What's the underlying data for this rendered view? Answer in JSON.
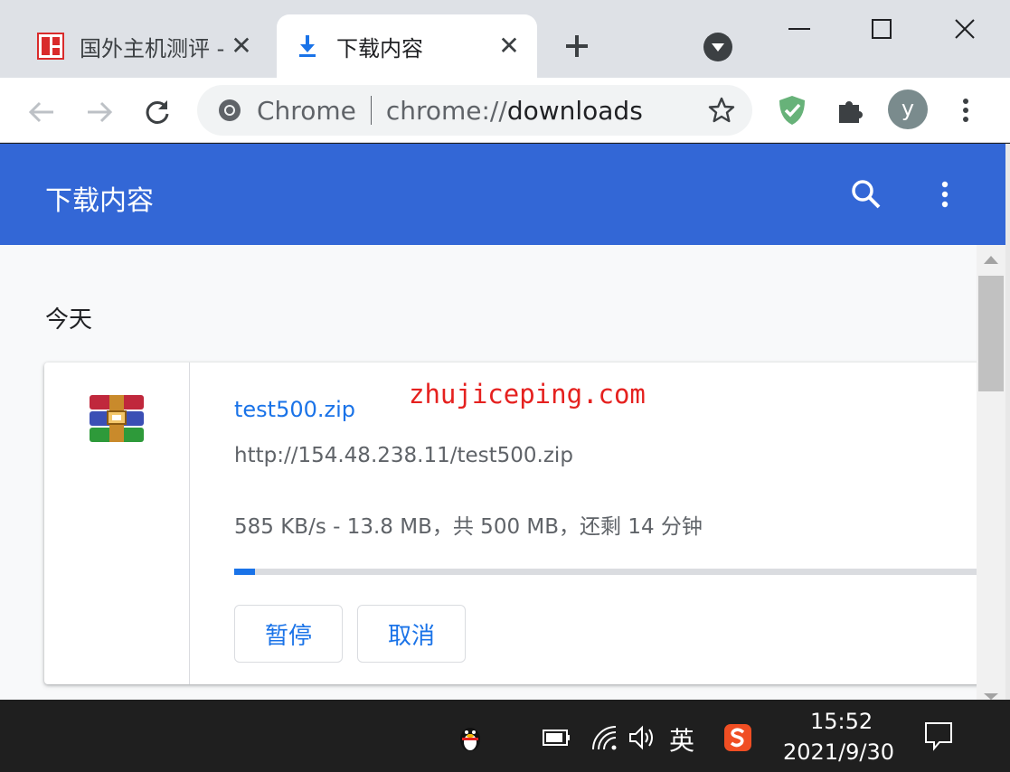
{
  "tabs": [
    {
      "title": "国外主机测评 - ",
      "close": "✕",
      "icon": "site-favicon-red"
    },
    {
      "title": "下载内容",
      "close": "✕",
      "icon": "download-icon"
    }
  ],
  "toolbar": {
    "omnibox_chip": "Chrome",
    "url_scheme": "chrome://",
    "url_path": "downloads",
    "avatar_letter": "y"
  },
  "downloads_page": {
    "title": "下载内容",
    "section_today": "今天",
    "item": {
      "file_name": "test500.zip",
      "watermark": "zhujiceping.com",
      "url": "http://154.48.238.11/test500.zip",
      "status": "585 KB/s - 13.8 MB，共 500 MB，还剩 14 分钟",
      "progress_fraction": 0.0276,
      "pause_label": "暂停",
      "cancel_label": "取消"
    }
  },
  "taskbar": {
    "lang": "英",
    "time": "15:52",
    "date": "2021/9/30"
  },
  "colors": {
    "header_blue": "#3367d6",
    "link_blue": "#1a73e8",
    "watermark_red": "#e5211f"
  }
}
